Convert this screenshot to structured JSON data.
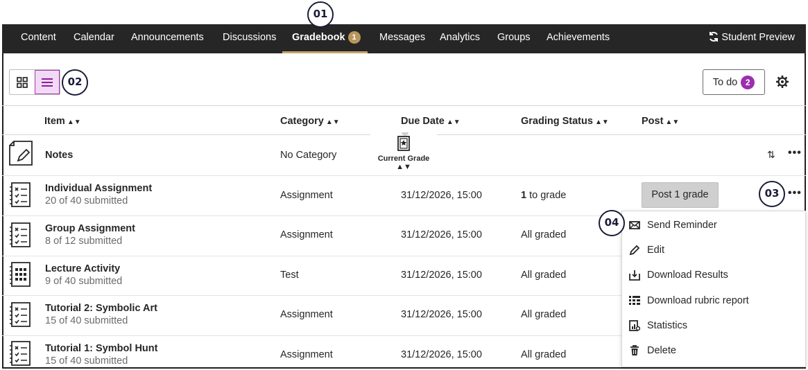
{
  "callouts": [
    "01",
    "02",
    "03",
    "04"
  ],
  "nav": {
    "tabs": [
      {
        "label": "Content"
      },
      {
        "label": "Calendar"
      },
      {
        "label": "Announcements"
      },
      {
        "label": "Discussions"
      },
      {
        "label": "Gradebook",
        "badge": "1",
        "active": true
      },
      {
        "label": "Messages"
      },
      {
        "label": "Analytics"
      },
      {
        "label": "Groups"
      },
      {
        "label": "Achievements"
      }
    ],
    "student_preview": "Student Preview"
  },
  "toolbar": {
    "view_grid_icon": "grid-view-icon",
    "view_list_icon": "list-view-icon",
    "todo_label": "To do",
    "todo_count": "2",
    "settings_icon": "gear-icon"
  },
  "table": {
    "headers": [
      "Item",
      "Category",
      "Due Date",
      "Grading Status",
      "Post"
    ],
    "current_grade_label": "Current Grade",
    "rows": [
      {
        "title": "Notes",
        "sub": "",
        "category": "No Category",
        "due": "",
        "status": "",
        "icon": "notes-icon"
      },
      {
        "title": "Individual Assignment",
        "sub": "20 of 40 submitted",
        "category": "Assignment",
        "due": "31/12/2026, 15:00",
        "status_count": "1",
        "status": "to grade",
        "post": "Post 1 grade",
        "icon": "assignment-icon"
      },
      {
        "title": "Group Assignment",
        "sub": "8 of 12 submitted",
        "category": "Assignment",
        "due": "31/12/2026, 15:00",
        "status": "All graded",
        "icon": "assignment-icon"
      },
      {
        "title": "Lecture Activity",
        "sub": "9 of 40 submitted",
        "category": "Test",
        "due": "31/12/2026, 15:00",
        "status": "All graded",
        "icon": "test-icon"
      },
      {
        "title": "Tutorial 2: Symbolic Art",
        "sub": "15 of 40 submitted",
        "category": "Assignment",
        "due": "31/12/2026, 15:00",
        "status": "All graded",
        "icon": "assignment-icon"
      },
      {
        "title": "Tutorial 1: Symbol Hunt",
        "sub": "15 of 40 submitted",
        "category": "Assignment",
        "due": "31/12/2026, 15:00",
        "status": "All graded",
        "icon": "assignment-icon"
      }
    ]
  },
  "menu": {
    "items": [
      {
        "label": "Send Reminder",
        "icon": "envelope-icon"
      },
      {
        "label": "Edit",
        "icon": "pencil-icon"
      },
      {
        "label": "Download Results",
        "icon": "download-icon"
      },
      {
        "label": "Download rubric report",
        "icon": "rubric-icon"
      },
      {
        "label": "Statistics",
        "icon": "statistics-icon"
      },
      {
        "label": "Delete",
        "icon": "trash-icon"
      }
    ]
  },
  "colors": {
    "nav_bg": "#262626",
    "active_underline": "#c9a36b",
    "gold_badge": "#b8965c",
    "purple_badge": "#9b2fae",
    "list_toggle_bg": "#f2d9f5"
  }
}
